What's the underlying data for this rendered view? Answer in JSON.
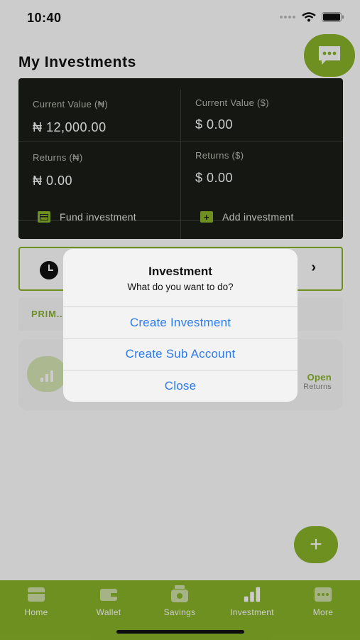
{
  "status_bar": {
    "time": "10:40"
  },
  "page": {
    "title": "My Investments"
  },
  "summary": {
    "current_value_ngn_label": "Current Value (₦)",
    "current_value_ngn": "₦ 12,000.00",
    "current_value_usd_label": "Current Value ($)",
    "current_value_usd": "$ 0.00",
    "returns_ngn_label": "Returns (₦)",
    "returns_ngn": "₦ 0.00",
    "returns_usd_label": "Returns ($)",
    "returns_usd": "$ 0.00",
    "fund_label": "Fund investment",
    "add_label": "Add investment"
  },
  "primary": {
    "label": "PRIM..."
  },
  "plan": {
    "status": "Open",
    "sub": "Returns"
  },
  "tabs": [
    {
      "label": "Home",
      "icon": "home-icon"
    },
    {
      "label": "Wallet",
      "icon": "wallet-icon"
    },
    {
      "label": "Savings",
      "icon": "savings-icon"
    },
    {
      "label": "Investment",
      "icon": "investment-icon"
    },
    {
      "label": "More",
      "icon": "more-icon"
    }
  ],
  "dialog": {
    "title": "Investment",
    "message": "What do you want to do?",
    "actions": [
      "Create Investment",
      "Create Sub Account",
      "Close"
    ]
  },
  "colors": {
    "accent": "#8ab52a",
    "card_dark": "#1b1e17",
    "link": "#2f7be8"
  }
}
